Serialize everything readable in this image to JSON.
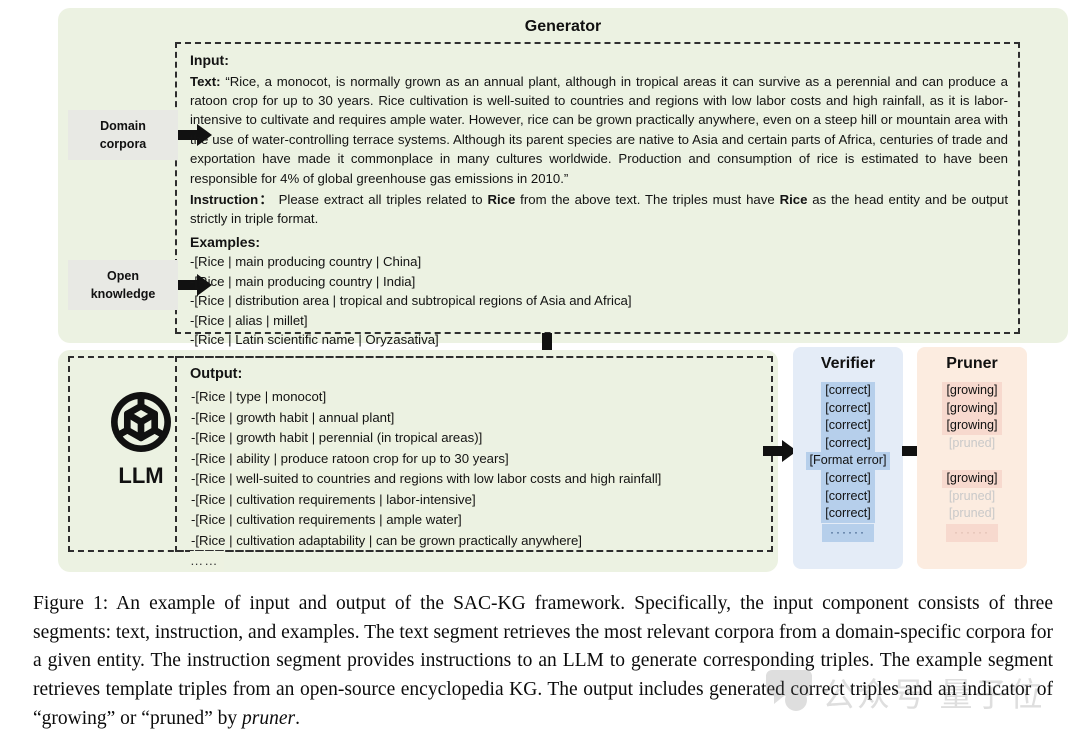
{
  "figure": {
    "generator_title": "Generator",
    "sources": [
      {
        "name": "domain-corpora",
        "line1": "Domain",
        "line2": "corpora"
      },
      {
        "name": "open-knowledge",
        "line1": "Open",
        "line2": "knowledge"
      }
    ],
    "input": {
      "header": "Input:",
      "text_label": "Text:",
      "text_body": "“Rice, a monocot, is normally grown as an annual plant, although in tropical areas it can survive as a perennial and can produce a ratoon crop for up to 30 years. Rice cultivation is well-suited to countries and regions with low labor costs and high rainfall, as it is labor-intensive to cultivate and requires ample water. However, rice can be grown practically anywhere, even on a steep hill or mountain area with the use of water-controlling terrace systems. Although its parent species are native to Asia and certain parts of Africa, centuries of trade and exportation have made it commonplace in many cultures worldwide. Production and consumption of rice is estimated to have been responsible for 4% of global greenhouse gas emissions in 2010.”",
      "instruction_label": "Instruction：",
      "instruction_part1": " Please extract all triples related to ",
      "instruction_entity1": "Rice",
      "instruction_part2": " from the above text. The triples must have ",
      "instruction_entity2": "Rice",
      "instruction_part3": " as the head entity and be output strictly in triple format.",
      "examples_header": "Examples:",
      "examples": [
        "-[Rice | main producing country | China]",
        "-[Rice | main producing country | India]",
        "-[Rice | distribution area | tropical and subtropical regions of Asia and Africa]",
        "-[Rice | alias | millet]",
        "-[Rice | Latin scientific name | Oryzasativa]"
      ]
    },
    "llm": {
      "label": "LLM",
      "icon": "openai-logo-icon"
    },
    "output": {
      "header": "Output:",
      "triples": [
        "-[Rice | type | monocot]",
        "-[Rice | growth habit | annual plant]",
        "-[Rice | growth habit | perennial (in tropical areas)]",
        "-[Rice | ability | produce ratoon crop for up to 30 years]",
        "-[Rice | well-suited to countries and regions with low labor costs and high rainfall]",
        "-[Rice | cultivation requirements | labor-intensive]",
        "-[Rice | cultivation requirements | ample water]",
        "-[Rice | cultivation adaptability | can be grown practically anywhere]"
      ],
      "ellipsis": "……"
    },
    "verifier": {
      "title": "Verifier",
      "items": [
        "[correct]",
        "[correct]",
        "[correct]",
        "[correct]",
        "[Format error]",
        "[correct]",
        "[correct]",
        "[correct]"
      ],
      "ellipsis": "······"
    },
    "pruner": {
      "title": "Pruner",
      "items": [
        {
          "label": "[growing]",
          "state": "growing"
        },
        {
          "label": "[growing]",
          "state": "growing"
        },
        {
          "label": "[growing]",
          "state": "growing"
        },
        {
          "label": "[pruned]",
          "state": "pruned"
        },
        {
          "label": "[blank]",
          "state": "blank"
        },
        {
          "label": "[growing]",
          "state": "growing"
        },
        {
          "label": "[pruned]",
          "state": "pruned"
        },
        {
          "label": "[pruned]",
          "state": "pruned"
        }
      ],
      "ellipsis": "······"
    },
    "colors": {
      "panel_green": "#ecf2e2",
      "verifier_bg": "#e4ecf7",
      "verifier_item": "#b6cfeb",
      "pruner_bg": "#fcece0",
      "pruner_item": "#f7d9ce",
      "source_box": "#e8e9e4",
      "arrow": "#111111"
    }
  },
  "caption": {
    "prefix": "Figure 1:",
    "body": " An example of input and output of the SAC-KG framework. Specifically, the input component consists of three segments: text, instruction, and examples. The text segment retrieves the most relevant corpora from a domain-specific corpora for a given entity. The instruction segment provides instructions to an LLM to generate corresponding triples. The example segment retrieves template triples from an open-source encyclopedia KG. The output includes generated correct triples and an indicator of “growing” or “pruned” by ",
    "italic_word": "pruner",
    "suffix": "."
  },
  "watermark": {
    "text": "公众号 量子位"
  }
}
